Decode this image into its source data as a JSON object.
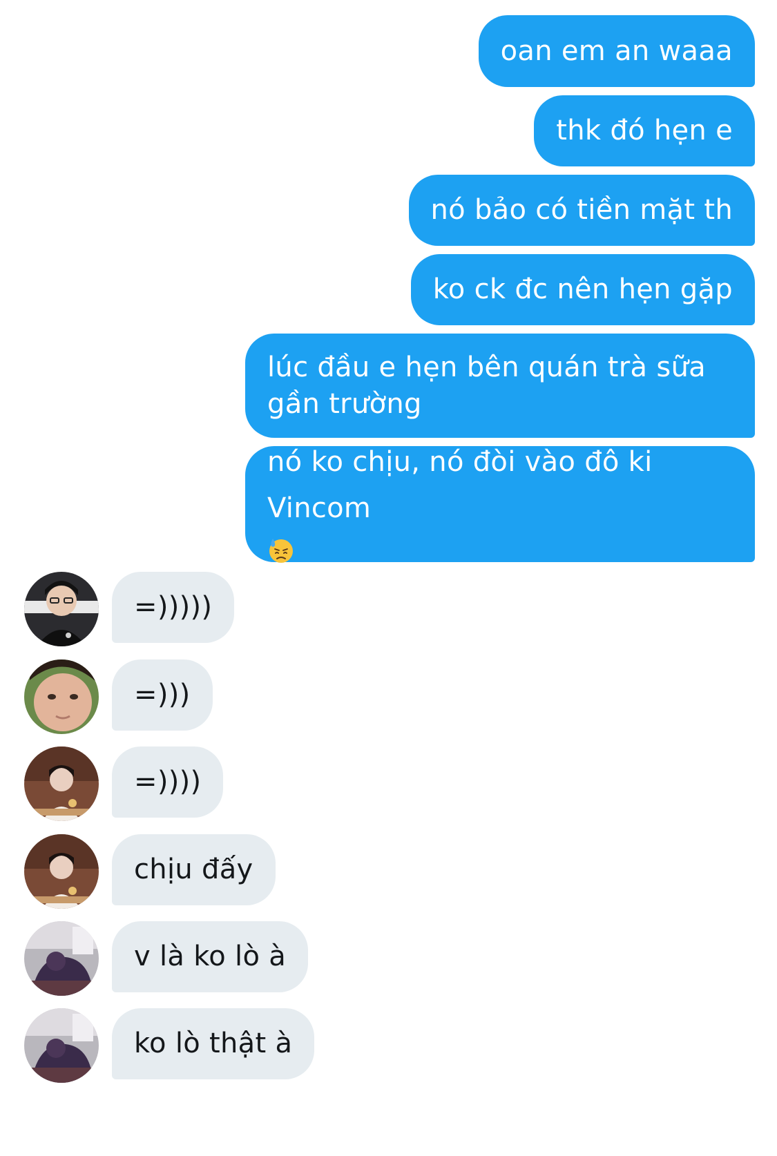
{
  "colors": {
    "outgoing_bubble": "#1da1f2",
    "incoming_bubble": "#e6ecf0"
  },
  "messages": [
    {
      "direction": "outgoing",
      "text": "oan em an waaa"
    },
    {
      "direction": "outgoing",
      "text": "thk đó hẹn e"
    },
    {
      "direction": "outgoing",
      "text": "nó bảo có tiền mặt th"
    },
    {
      "direction": "outgoing",
      "text": "ko ck đc nên hẹn gặp"
    },
    {
      "direction": "outgoing",
      "lines": [
        "lúc đầu e hẹn bên quán trà sữa",
        "gần trường"
      ]
    },
    {
      "direction": "outgoing",
      "lines": [
        "nó ko chịu, nó đòi vào đô ki",
        "Vincom"
      ],
      "emoji": "downcast-face-with-sweat"
    },
    {
      "direction": "incoming",
      "text": "=)))))",
      "avatar": "avatar-1"
    },
    {
      "direction": "incoming",
      "text": "=)))",
      "avatar": "avatar-2"
    },
    {
      "direction": "incoming",
      "text": "=))))",
      "avatar": "avatar-3"
    },
    {
      "direction": "incoming",
      "text": "chịu đấy",
      "avatar": "avatar-3"
    },
    {
      "direction": "incoming",
      "text": "v là ko lò à",
      "avatar": "avatar-4"
    },
    {
      "direction": "incoming",
      "text": "ko lò thật à",
      "avatar": "avatar-4"
    }
  ]
}
